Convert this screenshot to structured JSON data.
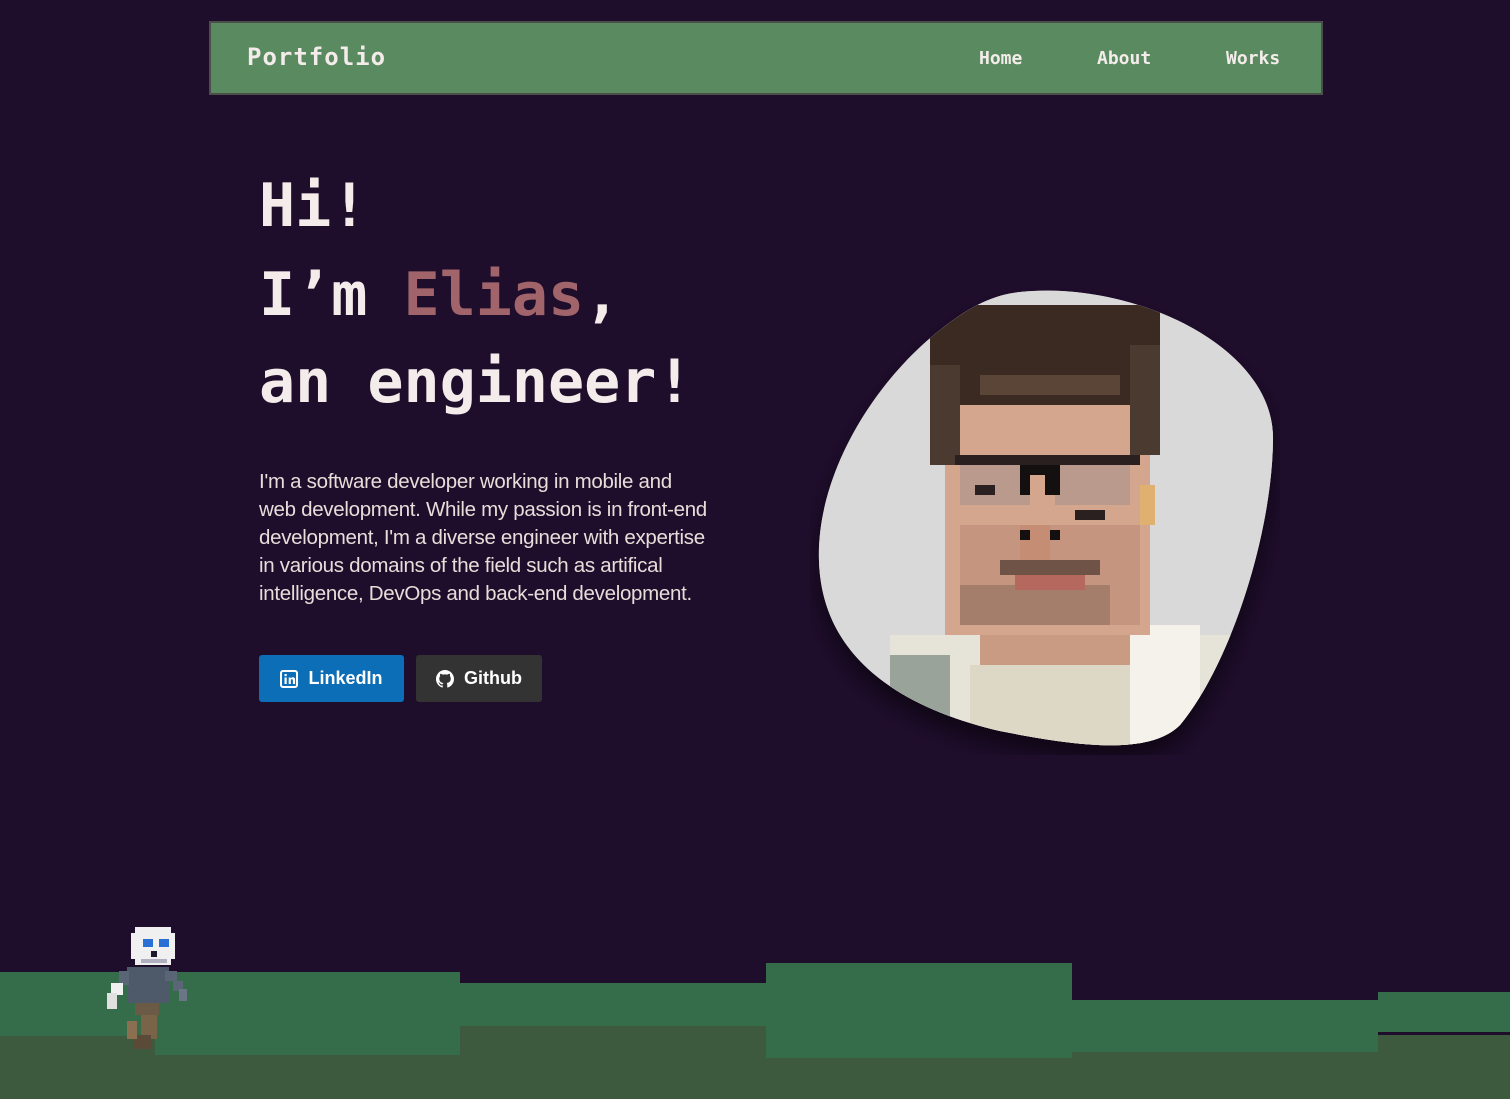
{
  "nav": {
    "brand": "Portfolio",
    "links": [
      "Home",
      "About",
      "Works"
    ]
  },
  "hero": {
    "greeting": "Hi!",
    "name_prefix": "I’m ",
    "name": "Elias",
    "name_suffix": ",",
    "role": "an engineer!",
    "intro": "I'm a software developer working in mobile and web development. While my passion is in front-end development, I'm a diverse engineer with expertise in various domains of the field such as artifical intelligence, DevOps and back-end development."
  },
  "buttons": {
    "linkedin": "LinkedIn",
    "github": "Github"
  },
  "colors": {
    "background": "#1f0d2c",
    "navbar": "#5a8a5f",
    "accent": "#a0646a",
    "linkedin": "#0b6eb6",
    "github": "#333333",
    "grass_top": "#356c4a",
    "grass_bottom": "#3d5a3e"
  },
  "icons": {
    "linkedin": "linkedin-icon",
    "github": "github-icon"
  }
}
